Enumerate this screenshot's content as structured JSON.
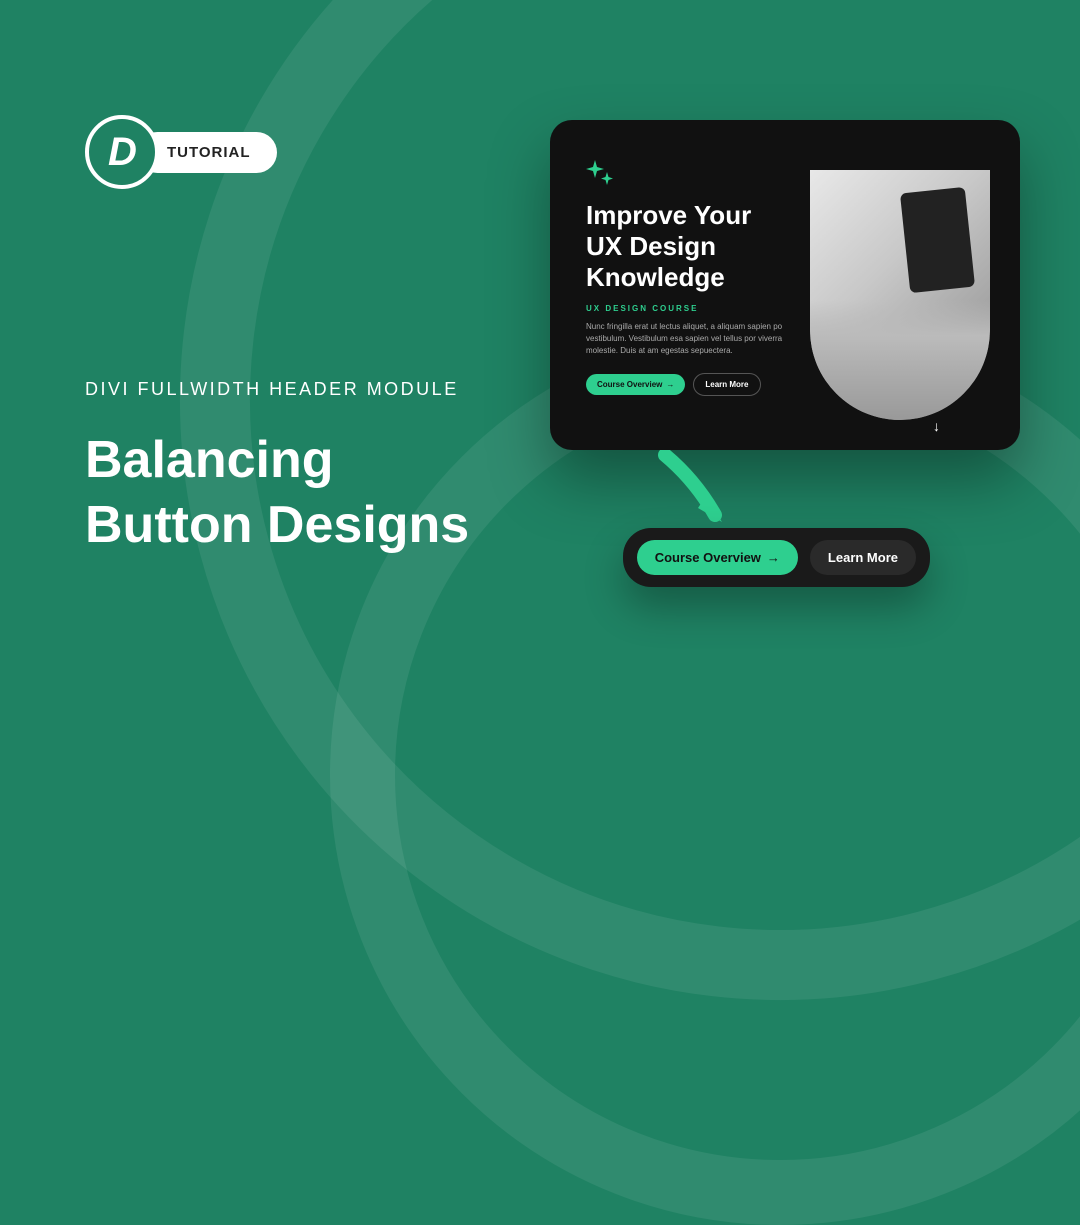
{
  "badge": {
    "logo_letter": "D",
    "pill_label": "TUTORIAL"
  },
  "eyebrow": "DIVI FULLWIDTH HEADER MODULE",
  "headline_line1": "Balancing",
  "headline_line2": "Button Designs",
  "device": {
    "title_l1": "Improve Your",
    "title_l2": "UX Design",
    "title_l3": "Knowledge",
    "subhead": "UX DESIGN COURSE",
    "body": "Nunc fringilla erat ut lectus aliquet, a aliquam sapien po vestibulum. Vestibulum esa sapien vel tellus por viverra molestie. Duis at am egestas sepuectera.",
    "primary_label": "Course Overview",
    "primary_arrow": "→",
    "secondary_label": "Learn More",
    "scroll_indicator": "↓"
  },
  "callout": {
    "primary_label": "Course Overview",
    "primary_arrow": "→",
    "secondary_label": "Learn More"
  },
  "colors": {
    "bg": "#1f8263",
    "accent": "#2ecf8f",
    "dark": "#111"
  }
}
